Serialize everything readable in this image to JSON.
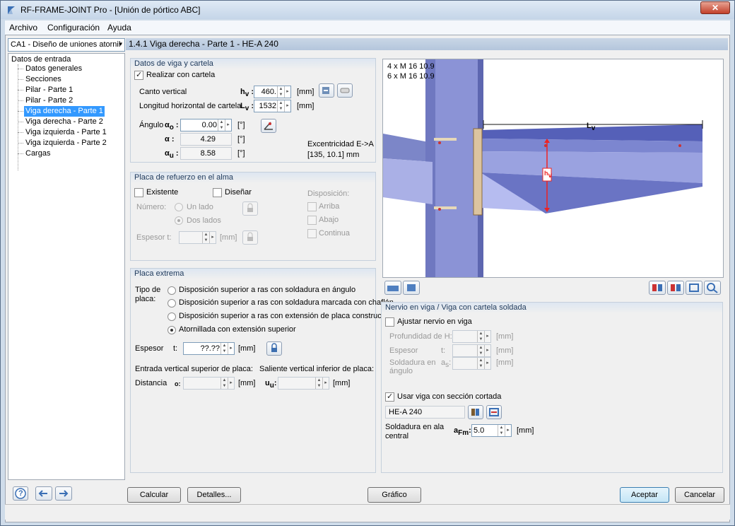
{
  "window": {
    "title": "RF-FRAME-JOINT Pro - [Unión de pórtico ABC]",
    "close": "✕"
  },
  "menu": [
    "Archivo",
    "Configuración",
    "Ayuda"
  ],
  "nav": {
    "combo": "CA1 - Diseño de uniones atornil",
    "combo_arrow": "▾",
    "root": "Datos de entrada",
    "items": [
      "Datos generales",
      "Secciones",
      "Pilar - Parte 1",
      "Pilar - Parte 2",
      "Viga derecha - Parte 1",
      "Viga derecha - Parte 2",
      "Viga izquierda - Parte 1",
      "Viga izquierda - Parte 2",
      "Cargas"
    ],
    "selected": 4
  },
  "header": "1.4.1 Viga derecha - Parte 1 - HE-A 240",
  "haunch": {
    "title": "Datos de viga y cartela",
    "check_label": "Realizar con cartela",
    "depth_label": "Canto vertical",
    "depth_sym": "h",
    "depth_sub": "v",
    "depth_value": "460.",
    "depth_unit": "[mm]",
    "length_label": "Longitud horizontal de cartela",
    "length_sym": "L",
    "length_sub": "v",
    "length_value": "1532",
    "length_unit": "[mm]",
    "angle_label": "Ángulo",
    "a0_sym": "α",
    "a0_sub": "o",
    "a0_value": "0.00",
    "a_sym": "α",
    "a_value": "4.29",
    "au_sym": "α",
    "au_sub": "u",
    "au_value": "8.58",
    "deg": "[°]",
    "ecc_label": "Excentricidad E->A",
    "ecc_value": "[135, 10.1] mm"
  },
  "stiffener": {
    "title": "Placa de refuerzo en el alma",
    "existing": "Existente",
    "design": "Diseñar",
    "number": "Número:",
    "one_side": "Un lado",
    "two_sides": "Dos lados",
    "thickness": "Espesor",
    "t": "t:",
    "unit": "[mm]",
    "layout": "Disposición:",
    "top": "Arriba",
    "bottom": "Abajo",
    "continuous": "Continua"
  },
  "endplate": {
    "title": "Placa extrema",
    "type_label": "Tipo de placa:",
    "options": [
      "Disposición superior a ras con soldadura en ángulo",
      "Disposición superior a ras con soldadura marcada con chaflán",
      "Disposición superior a ras con extensión de placa constructiva",
      "Atornillada con extensión superior"
    ],
    "selected": 3,
    "thick_label": "Espesor",
    "t": "t:",
    "thick_value": "??.??",
    "unit": "[mm]",
    "top_label": "Entrada vertical superior de placa:",
    "bottom_label": "Saliente vertical inferior de placa:",
    "dist_label": "Distancia",
    "o_sym": "o:",
    "u_sym": "u",
    "u_sub": "u",
    "u_colon": ":"
  },
  "graphic": {
    "bolts": [
      "4 x M 16 10.9",
      "6 x M 16 10.9"
    ],
    "lv": "L",
    "lv_sub": "v",
    "hv": "h",
    "hv_sub": "v"
  },
  "rib": {
    "title": "Nervio en viga / Viga con cartela soldada",
    "adjust": "Ajustar nervio en viga",
    "depth": "Profundidad de",
    "h_sym": "H:",
    "thick": "Espesor",
    "t_sym": "t:",
    "weld": "Soldadura en ángulo",
    "as_sym": "a",
    "as_sub": "s",
    "as_colon": ":",
    "unit": "[mm]",
    "use_cut": "Usar viga con sección cortada",
    "section": "HE-A 240",
    "web_weld": "Soldadura en ala central",
    "afm_sym": "a",
    "afm_sub": "Fm",
    "afm_colon": ":",
    "afm_value": "5.0"
  },
  "buttons": {
    "calc": "Calcular",
    "details": "Detalles...",
    "graphic": "Gráfico",
    "accept": "Aceptar",
    "cancel": "Cancelar"
  },
  "glyphs": {
    "up": "▲",
    "down": "▼",
    "right": "▸",
    "question": "?"
  }
}
